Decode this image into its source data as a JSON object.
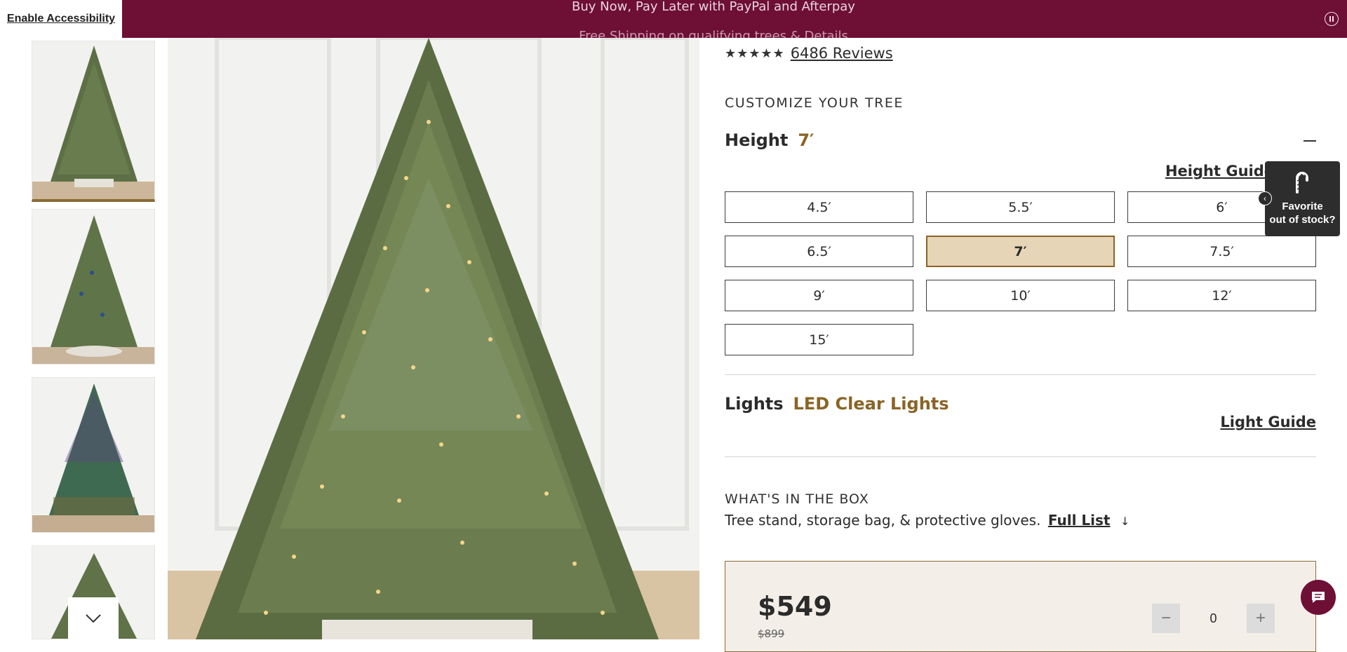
{
  "banner": {
    "accessibility_label": "Enable Accessibility",
    "message": "Buy Now, Pay Later with PayPal and Afterpay",
    "message_next": "Free Shipping on qualifying trees & Details",
    "pause_icon": "pause-icon"
  },
  "gallery": {
    "scroll_icon": "chevron-down-icon"
  },
  "product": {
    "stars": "★★★★★",
    "rating": 4.5,
    "reviews_label": "6486 Reviews",
    "customize_title": "CUSTOMIZE YOUR TREE",
    "height_label": "Height",
    "height_value": "7′",
    "height_guide_label": "Height Guide",
    "sizes": [
      "4.5′",
      "5.5′",
      "6′",
      "6.5′",
      "7′",
      "7.5′",
      "9′",
      "10′",
      "12′",
      "15′"
    ],
    "selected_size": "7′",
    "lights_label": "Lights",
    "lights_value": "LED Clear Lights",
    "light_guide_label": "Light Guide",
    "box_title": "WHAT'S IN THE BOX",
    "box_text": "Tree stand, storage bag, & protective gloves.",
    "full_list_label": "Full List",
    "full_list_arrow": "↓",
    "price": "$549",
    "old_price": "$899",
    "qty_minus": "−",
    "qty_value": "0",
    "qty_plus": "+"
  },
  "popup": {
    "line1": "Favorite",
    "line2": "out of stock?",
    "close_icon": "‹"
  },
  "colors": {
    "brand": "#6e0f35",
    "accent": "#8a6426",
    "selected_bg": "#e6d5b7"
  }
}
